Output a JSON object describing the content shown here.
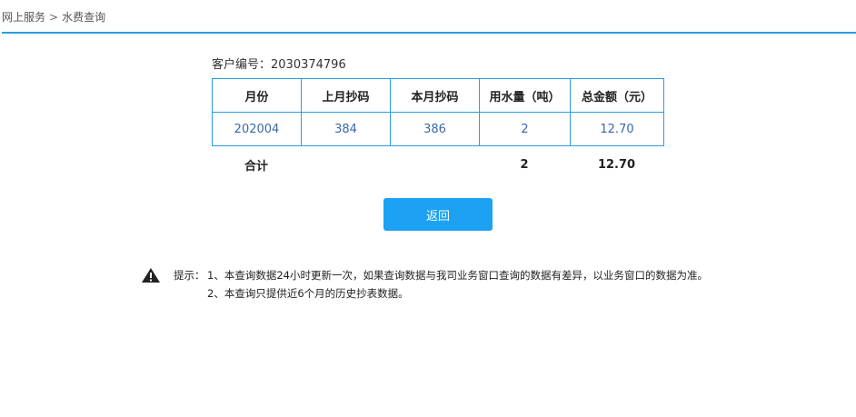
{
  "breadcrumb": {
    "home": "网上服务",
    "separator": ">",
    "current": "水费查询"
  },
  "customer": {
    "label": "客户编号：",
    "number": "2030374796"
  },
  "table": {
    "headers": [
      "月份",
      "上月抄码",
      "本月抄码",
      "用水量（吨）",
      "总金额（元）"
    ],
    "rows": [
      [
        "202004",
        "384",
        "386",
        "2",
        "12.70"
      ]
    ]
  },
  "total": {
    "label": "合计",
    "usage": "2",
    "amount": "12.70"
  },
  "back_button": "返回",
  "tips": {
    "label": "提示：",
    "line1": "1、本查询数据24小时更新一次，如果查询数据与我司业务窗口查询的数据有差异，以业务窗口的数据为准。",
    "line2": "2、本查询只提供近6个月的历史抄表数据。"
  },
  "colors": {
    "accent": "#2a9de0",
    "button": "#1da1f2",
    "cell_text": "#3a68a8"
  },
  "icons": {
    "tips": "warning-triangle-icon"
  }
}
